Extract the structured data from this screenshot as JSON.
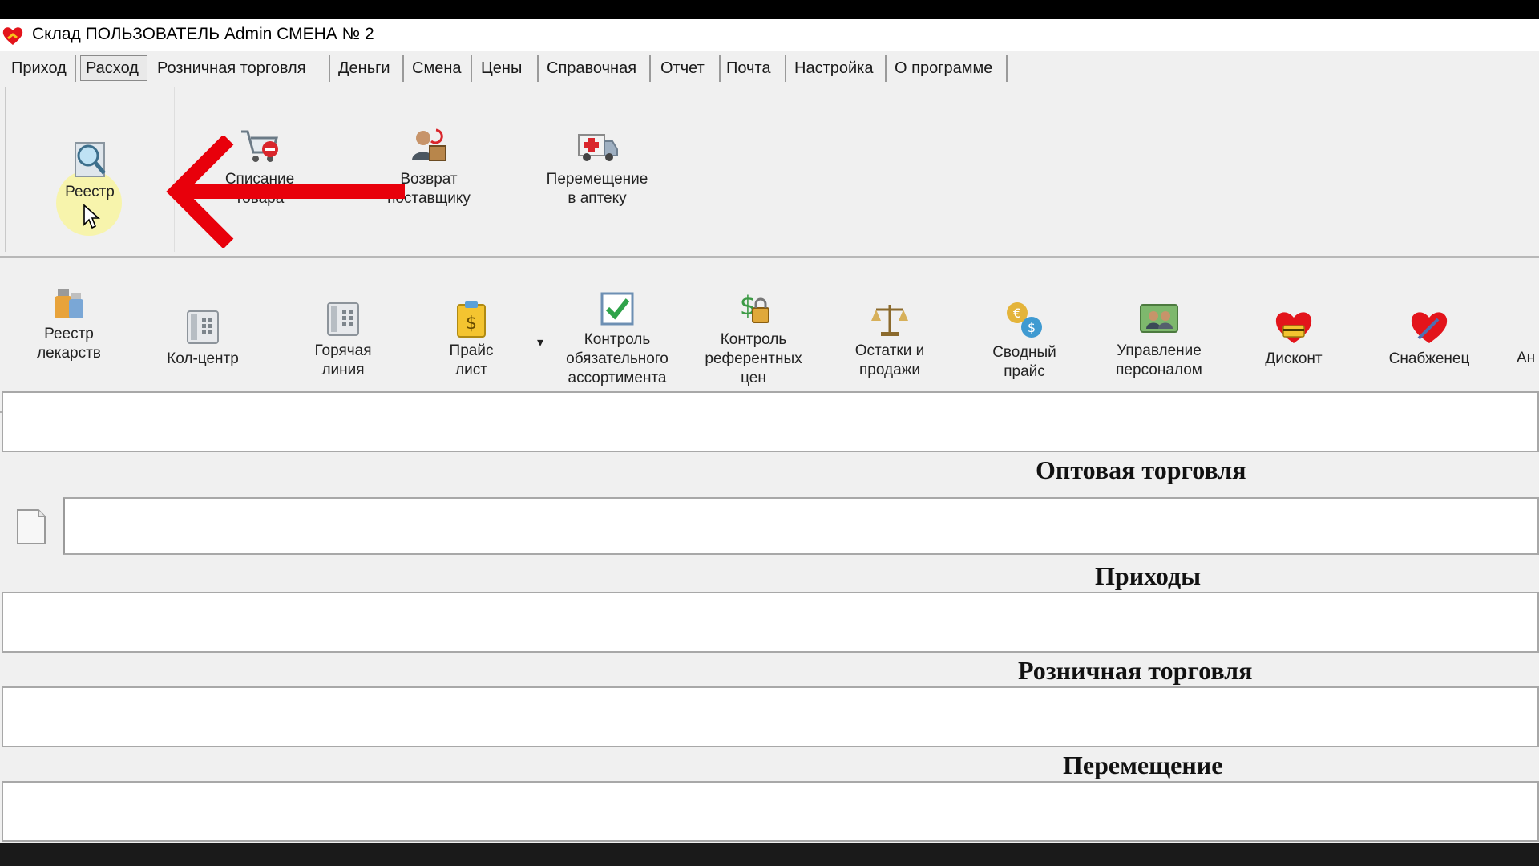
{
  "window": {
    "title": "Склад ПОЛЬЗОВАТЕЛЬ Admin СМЕНА № 2",
    "icon": "heart-icon"
  },
  "menu": [
    {
      "label": "Приход"
    },
    {
      "label": "Расход",
      "active": true
    },
    {
      "label": "Розничная торговля"
    },
    {
      "label": "Деньги"
    },
    {
      "label": "Смена"
    },
    {
      "label": "Цены"
    },
    {
      "label": "Справочная"
    },
    {
      "label": "Отчет"
    },
    {
      "label": "Почта"
    },
    {
      "label": "Настройка"
    },
    {
      "label": "О программе"
    }
  ],
  "ribbon_top": [
    {
      "label": "Реестр",
      "icon": "magnifier-icon"
    },
    {
      "label": "Списание\nтовара",
      "icon": "cart-remove-icon"
    },
    {
      "label": "Возврат\nпоставщику",
      "icon": "supplier-return-icon"
    },
    {
      "label": "Перемещение\nв аптеку",
      "icon": "ambulance-icon"
    }
  ],
  "ribbon_bottom": [
    {
      "label": "Реестр\nлекарств",
      "icon": "medicine-bottles-icon"
    },
    {
      "label": "Кол-центр",
      "icon": "phone-icon"
    },
    {
      "label": "Горячая\nлиния",
      "icon": "hotline-phone-icon"
    },
    {
      "label": "Прайс\nлист",
      "icon": "price-clipboard-icon",
      "dropdown": "▾"
    },
    {
      "label": "Контроль\nобязательного\nассортимента",
      "icon": "checkbox-icon"
    },
    {
      "label": "Контроль\nреферентных\nцен",
      "icon": "money-lock-icon"
    },
    {
      "label": "Остатки и\nпродажи",
      "icon": "scales-icon"
    },
    {
      "label": "Сводный\nпрайс",
      "icon": "currency-exchange-icon"
    },
    {
      "label": "Управление\nперсоналом",
      "icon": "staff-icon"
    },
    {
      "label": "Дисконт",
      "icon": "discount-heart-icon"
    },
    {
      "label": "Снабженец",
      "icon": "supply-heart-icon"
    },
    {
      "label": "Ан",
      "icon": ""
    }
  ],
  "sections": [
    {
      "title": "Оптовая торговля"
    },
    {
      "title": "Приходы"
    },
    {
      "title": "Розничная торговля"
    },
    {
      "title": "Перемещение"
    }
  ],
  "colors": {
    "arrow": "#e8000b",
    "highlight": "#faf596",
    "window_bg": "#f0f0f0"
  }
}
